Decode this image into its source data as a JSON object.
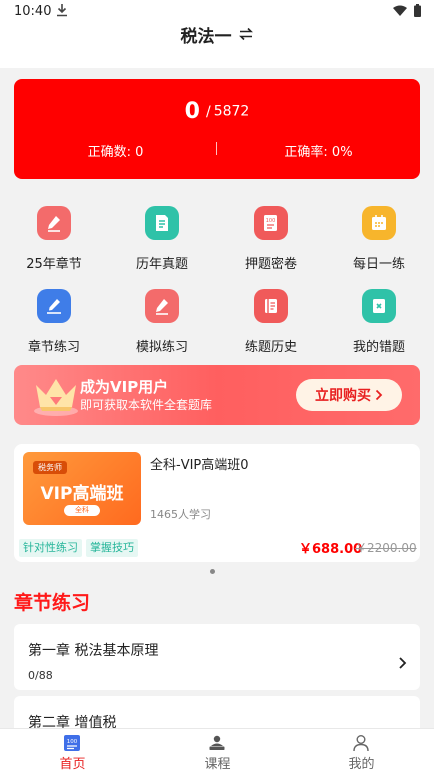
{
  "status_bar": {
    "time": "10:40"
  },
  "header": {
    "title": "税法一"
  },
  "score": {
    "correct_count": "0",
    "total": "5872",
    "correct_label": "正确数: 0",
    "accuracy_label": "正确率: 0%"
  },
  "grid": [
    {
      "label": "25年章节",
      "icon": "pen-icon",
      "color": "#f36b6b"
    },
    {
      "label": "历年真题",
      "icon": "document-icon",
      "color": "#2fc2a8"
    },
    {
      "label": "押题密卷",
      "icon": "exam-100-icon",
      "color": "#f05a5a"
    },
    {
      "label": "每日一练",
      "icon": "calendar-icon",
      "color": "#f7b52c"
    },
    {
      "label": "章节练习",
      "icon": "edit-icon",
      "color": "#3f7de8"
    },
    {
      "label": "模拟练习",
      "icon": "pen-icon",
      "color": "#f36b6b"
    },
    {
      "label": "练题历史",
      "icon": "history-icon",
      "color": "#f05a5a"
    },
    {
      "label": "我的错题",
      "icon": "error-book-icon",
      "color": "#2fc2a8"
    }
  ],
  "vip_banner": {
    "title": "成为VIP用户",
    "subtitle": "即可获取本软件全套题库",
    "button": "立即购买"
  },
  "course": {
    "thumb_tag": "税务师",
    "thumb_title": "VIP高端班",
    "thumb_pill": "全科",
    "title": "全科-VIP高端班0",
    "learners": "1465人学习",
    "tags": [
      "针对性练习",
      "掌握技巧"
    ],
    "price": "￥688.00",
    "original_price": "￥2200.00"
  },
  "section": {
    "title": "章节练习"
  },
  "chapters": [
    {
      "name": "第一章 税法基本原理",
      "progress": "0/88"
    },
    {
      "name": "第二章 增值税",
      "progress": ""
    }
  ],
  "tabbar": [
    {
      "label": "首页",
      "icon": "home-100-icon",
      "active": true
    },
    {
      "label": "课程",
      "icon": "course-icon",
      "active": false
    },
    {
      "label": "我的",
      "icon": "profile-icon",
      "active": false
    }
  ],
  "colors": {
    "accent": "#ff0000",
    "tab_active": "#e81f1f",
    "tab_inactive": "#666666"
  }
}
